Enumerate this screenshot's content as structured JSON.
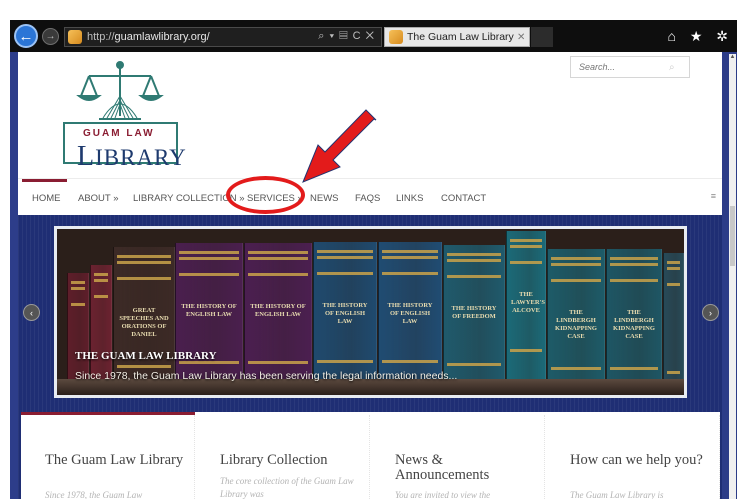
{
  "browser": {
    "url_prefix": "http://",
    "url_domain": "guamlawlibrary.org/",
    "address_icons": "⌕ ▾ ▤ C ✕",
    "tab_title": "The Guam Law Library | gu...",
    "tab_close": "✕",
    "right_icons": "⌂ ★ ✲"
  },
  "logo": {
    "line1": "GUAM LAW",
    "line2_initial": "L",
    "line2_rest": "IBRARY",
    "accent_color": "#8a1d32",
    "frame_color": "#2f7a73"
  },
  "search": {
    "placeholder": "Search...",
    "icon": "search-icon"
  },
  "nav": {
    "items": [
      {
        "label": "HOME"
      },
      {
        "label": "ABOUT »"
      },
      {
        "label": "LIBRARY COLLECTION »"
      },
      {
        "label": "SERVICES »"
      },
      {
        "label": "NEWS"
      },
      {
        "label": "FAQS"
      },
      {
        "label": "LINKS"
      },
      {
        "label": "CONTACT"
      }
    ],
    "more": "≡"
  },
  "slider": {
    "caption_title": "THE GUAM LAW LIBRARY",
    "caption_text": "Since 1978, the Guam Law Library has been serving the legal information needs...",
    "prev": "‹",
    "next": "›",
    "book_labels": [
      "GREAT SPEECHES AND ORATIONS OF DANIEL",
      "THE HISTORY OF ENGLISH LAW",
      "THE HISTORY OF ENGLISH LAW",
      "THE HISTORY OF ENGLISH LAW",
      "THE HISTORY OF ENGLISH LAW",
      "THE HISTORY OF FREEDOM",
      "THE LAWYER'S ALCOVE",
      "THE LINDBERGH KIDNAPPING CASE",
      "THE LINDBERGH KIDNAPPING CASE",
      "MA CH"
    ]
  },
  "boxes": [
    {
      "title": "The Guam Law Library",
      "text": "Since 1978, the Guam Law"
    },
    {
      "title": "Library Collection",
      "text": "The core collection of the Guam Law Library was"
    },
    {
      "title": "News & Announcements",
      "text": "You are invited to view the"
    },
    {
      "title": "How can we help you?",
      "text": "The Guam Law Library is"
    }
  ],
  "colors": {
    "page_bg": "#1f2e74",
    "accent": "#8a1d32",
    "annotation": "#e31b1b"
  }
}
